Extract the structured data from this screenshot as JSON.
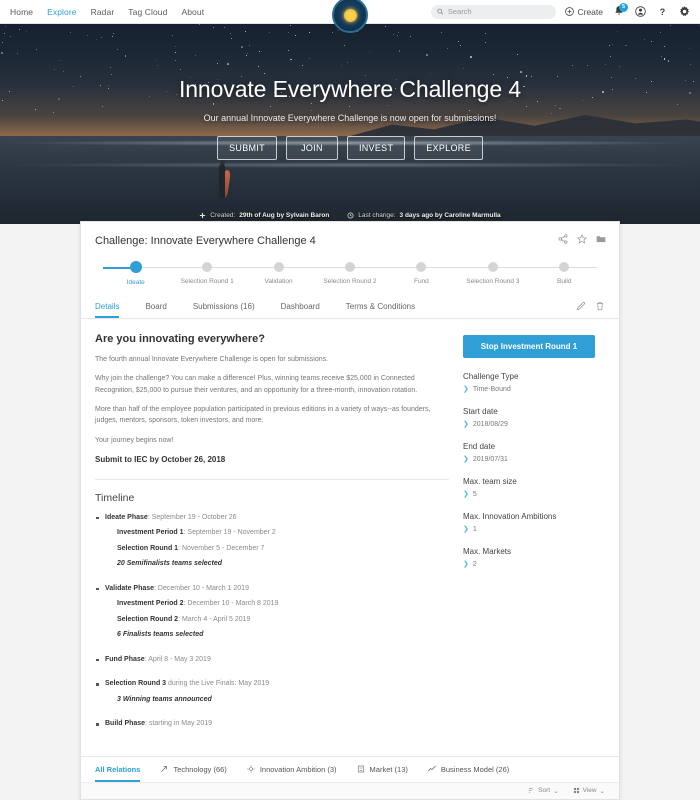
{
  "nav": {
    "links": [
      {
        "label": "Home",
        "active": false
      },
      {
        "label": "Explore",
        "active": true
      },
      {
        "label": "Radar",
        "active": false
      },
      {
        "label": "Tag Cloud",
        "active": false
      },
      {
        "label": "About",
        "active": false
      }
    ],
    "search_placeholder": "Search",
    "search_value": "",
    "create_label": "Create",
    "notification_count": "5",
    "brand_name": "innovation-badge-logo"
  },
  "hero": {
    "title": "Innovate Everywhere Challenge 4",
    "subtitle": "Our annual Innovate Everywhere Challenge is now open for submissions!",
    "buttons": [
      "SUBMIT",
      "JOIN",
      "INVEST",
      "EXPLORE"
    ],
    "created_label": "Created:",
    "created_value": "29th of Aug by Sylvain Baron",
    "modified_label": "Last change:",
    "modified_value": "3 days ago by Caroline Marmulla"
  },
  "card": {
    "title": "Challenge: Innovate Everywhere Challenge 4",
    "head_icons": [
      "share-icon",
      "star-icon",
      "folder-icon"
    ],
    "stepper": [
      {
        "label": "Ideate",
        "active": true
      },
      {
        "label": "Selection Round 1",
        "active": false
      },
      {
        "label": "Validation",
        "active": false
      },
      {
        "label": "Selection Round 2",
        "active": false
      },
      {
        "label": "Fund",
        "active": false
      },
      {
        "label": "Selection Round 3",
        "active": false
      },
      {
        "label": "Build",
        "active": false
      }
    ],
    "tabs": [
      {
        "label": "Details",
        "active": true
      },
      {
        "label": "Board",
        "active": false
      },
      {
        "label": "Submissions (16)",
        "active": false
      },
      {
        "label": "Dashboard",
        "active": false
      },
      {
        "label": "Terms & Conditions",
        "active": false
      }
    ],
    "tab_tools": [
      "edit-pencil-icon",
      "trash-icon"
    ]
  },
  "main": {
    "heading": "Are you innovating everywhere?",
    "paragraphs": [
      "The fourth annual Innovate Everywhere Challenge is open for submissions.",
      "Why join the challenge? You can make a difference! Plus, winning teams receive $25,000 in Connected Recognition, $25,000 to pursue their ventures, and an opportunity for a three-month, innovation rotation.",
      "More than half of the employee population participated in previous editions in a variety of ways--as founders, judges, mentors, sponsors, token investors, and more.",
      "Your journey begins now!"
    ],
    "callout": "Submit to IEC by October 26, 2018",
    "timeline_heading": "Timeline",
    "timeline": [
      {
        "name": "Ideate Phase",
        "dates": ": September 19 - October 26",
        "children": [
          {
            "name": "Investment Period 1",
            "dates": ": September 19 - November 2",
            "em": false
          },
          {
            "name": "Selection Round 1",
            "dates": ": November 5 - December 7",
            "em": false
          },
          {
            "name": "20 Semifinalists teams selected",
            "dates": "",
            "em": true
          }
        ]
      },
      {
        "name": "Validate Phase",
        "dates": ": December 10 - March 1 2019",
        "children": [
          {
            "name": "Investment Period 2",
            "dates": ": December 10 - March 8 2019",
            "em": false
          },
          {
            "name": "Selection Round 2",
            "dates": ": March 4 - April 5 2019",
            "em": false
          },
          {
            "name": "6 Finalists teams selected",
            "dates": "",
            "em": true
          }
        ]
      },
      {
        "name": "Fund Phase",
        "dates": ": April 8 - May 3 2019",
        "children": []
      },
      {
        "name": "Selection Round 3",
        "dates": " during the Live Finals: May 2019",
        "children": [
          {
            "name": "3 Winning teams announced",
            "dates": "",
            "em": true
          }
        ]
      },
      {
        "name": "Build Phase",
        "dates": ": starting in May 2019",
        "children": []
      }
    ]
  },
  "sidebar": {
    "action_button": "Stop Investment Round 1",
    "fields": [
      {
        "label": "Challenge Type",
        "value": "Time-Bound"
      },
      {
        "label": "Start date",
        "value": "2018/08/29"
      },
      {
        "label": "End date",
        "value": "2019/07/31"
      },
      {
        "label": "Max. team size",
        "value": "5"
      },
      {
        "label": "Max. Innovation Ambitions",
        "value": "1"
      },
      {
        "label": "Max. Markets",
        "value": "2"
      }
    ]
  },
  "relations": {
    "items": [
      {
        "label": "All Relations",
        "active": true,
        "icon": "none"
      },
      {
        "label": "Technology (66)",
        "active": false,
        "icon": "arrow-up-right-icon"
      },
      {
        "label": "Innovation Ambition (3)",
        "active": false,
        "icon": "target-icon"
      },
      {
        "label": "Market (13)",
        "active": false,
        "icon": "building-icon"
      },
      {
        "label": "Business Model (26)",
        "active": false,
        "icon": "trend-line-icon"
      }
    ],
    "sort_label": "Sort",
    "view_label": "View"
  },
  "colors": {
    "accent": "#2f9fd6",
    "accent_light": "#4fb3e6",
    "text_dark": "#333333",
    "text_muted": "#8a8a8a"
  }
}
